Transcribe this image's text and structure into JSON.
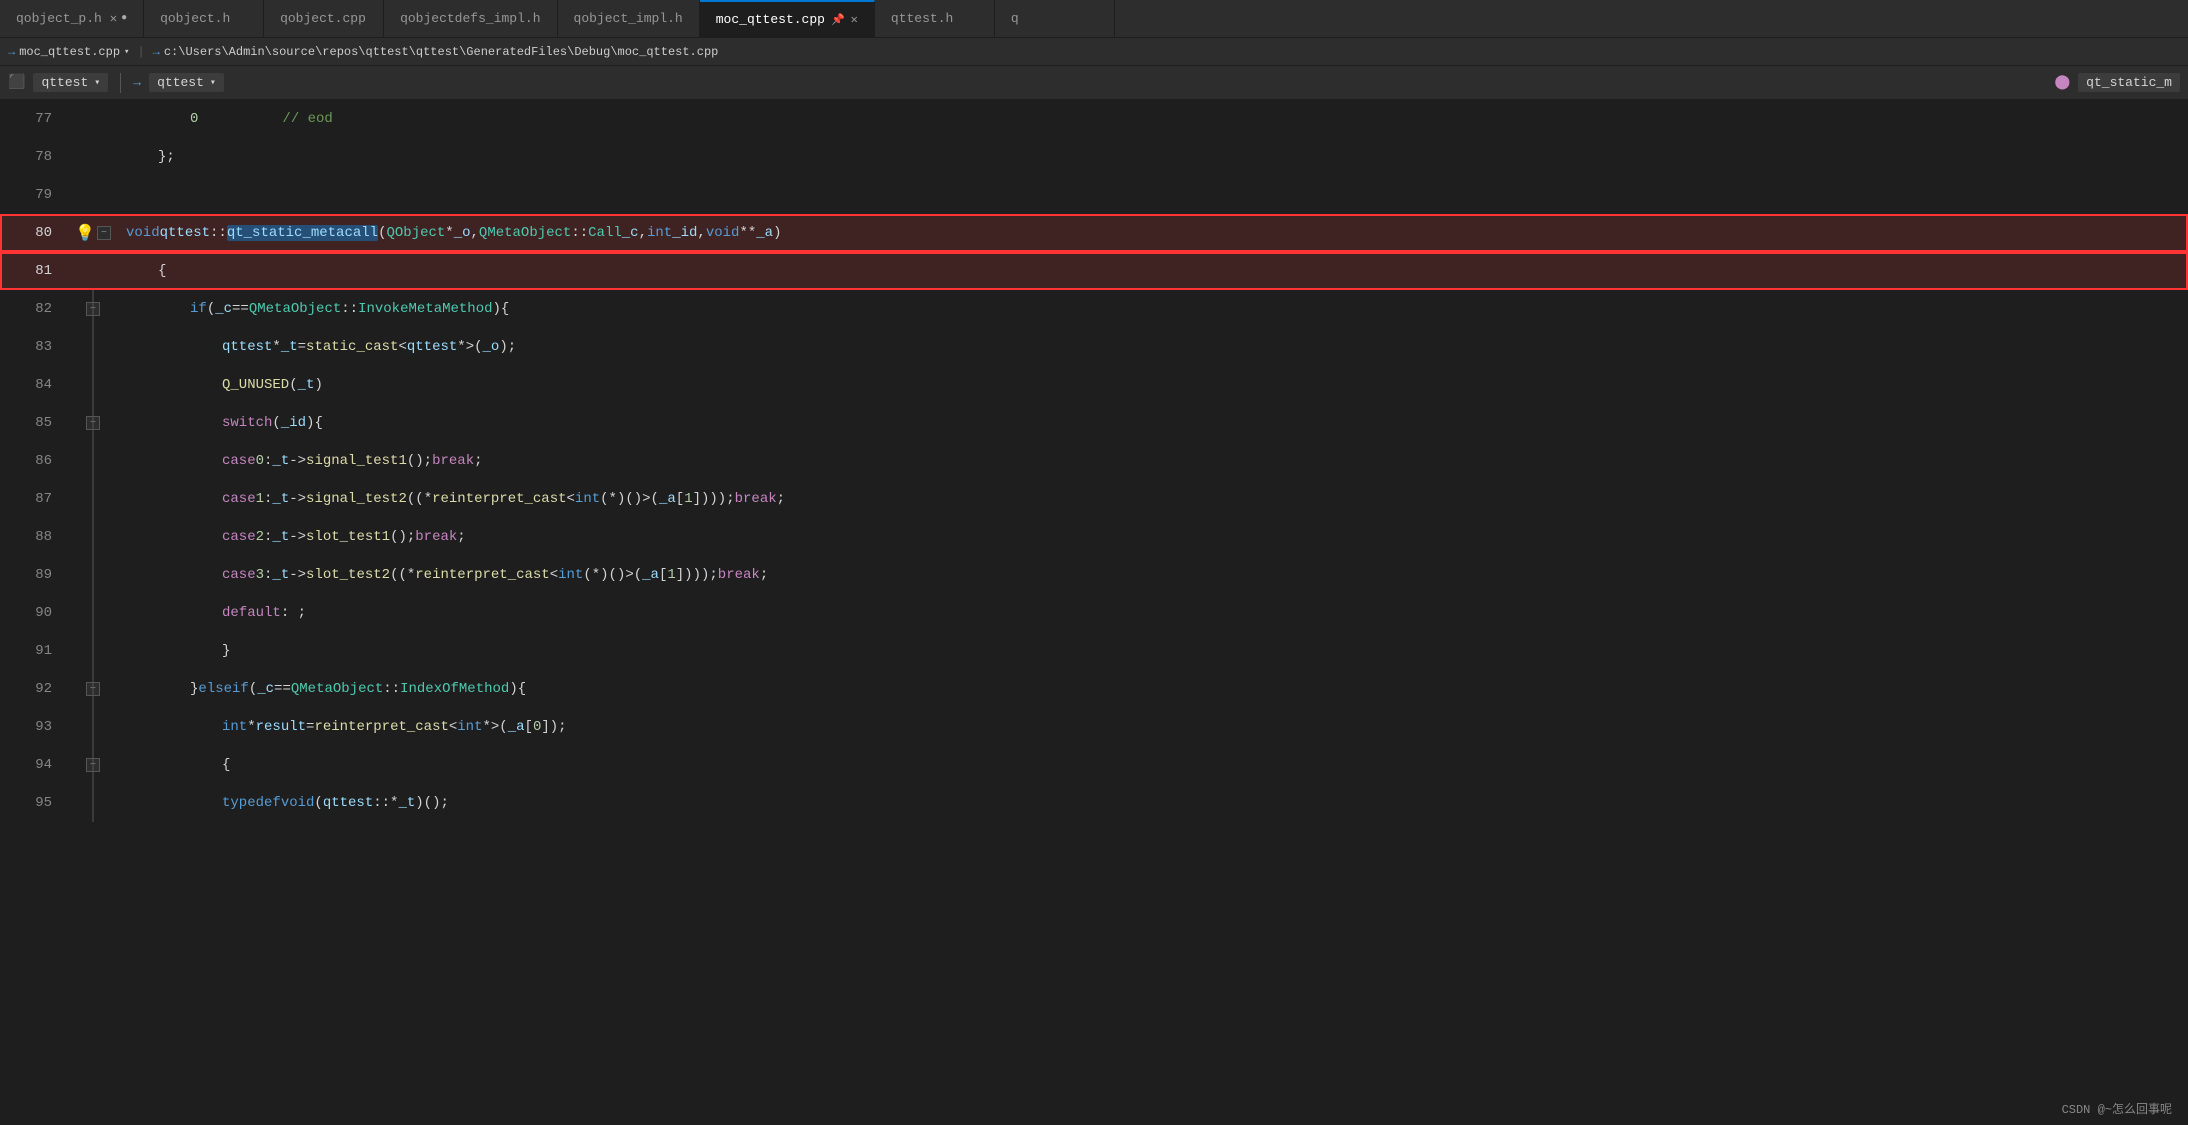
{
  "tabs": [
    {
      "label": "qobject_p.h",
      "modified": true,
      "active": false,
      "id": "tab-qobject-p-h"
    },
    {
      "label": "qobject.h",
      "modified": false,
      "active": false,
      "id": "tab-qobject-h"
    },
    {
      "label": "qobject.cpp",
      "modified": false,
      "active": false,
      "id": "tab-qobject-cpp"
    },
    {
      "label": "qobjectdefs_impl.h",
      "modified": false,
      "active": false,
      "id": "tab-qobjectdefs-impl-h"
    },
    {
      "label": "qobject_impl.h",
      "modified": false,
      "active": false,
      "id": "tab-qobject-impl-h"
    },
    {
      "label": "moc_qttest.cpp",
      "modified": false,
      "active": true,
      "pinned": true,
      "id": "tab-moc-qttest-cpp"
    },
    {
      "label": "qttest.h",
      "modified": false,
      "active": false,
      "id": "tab-qttest-h"
    },
    {
      "label": "q...",
      "modified": false,
      "active": false,
      "id": "tab-q-etc"
    }
  ],
  "breadcrumb": {
    "arrow1": "→",
    "file": "moc_qttest.cpp",
    "arrow2": "→",
    "path": "c:\\Users\\Admin\\source\\repos\\qttest\\qttest\\GeneratedFiles\\Debug\\moc_qttest.cpp"
  },
  "dropdowns": {
    "left_icon": "⬜",
    "left_label": "qttest",
    "arrow": "→",
    "right_label": "qttest",
    "far_right": "qt_static_m"
  },
  "lines": [
    {
      "num": 77,
      "indent": 0,
      "tokens": [
        {
          "t": "0",
          "c": "num"
        },
        {
          "t": "          // eod",
          "c": "cmt"
        }
      ],
      "fold": false,
      "gutter": "spacer"
    },
    {
      "num": 78,
      "indent": 0,
      "tokens": [
        {
          "t": "};",
          "c": "op"
        }
      ],
      "fold": false,
      "gutter": "spacer",
      "pre_indent": "    "
    },
    {
      "num": 79,
      "indent": 0,
      "tokens": [],
      "fold": false,
      "gutter": "none"
    },
    {
      "num": 80,
      "indent": 0,
      "tokens": [],
      "fold": "minus",
      "gutter": "bulb",
      "highlighted": true,
      "raw": "void qttest::<sel>qt_static_metacall</sel>(QObject *_o, QMetaObject::Call _c, int _id, void **_a)"
    },
    {
      "num": 81,
      "indent": 0,
      "tokens": [
        {
          "t": "    {",
          "c": "op"
        }
      ],
      "fold": false,
      "gutter": "spacer",
      "highlighted": true
    },
    {
      "num": 82,
      "indent": 1,
      "tokens": [],
      "fold": "minus",
      "gutter": "line",
      "raw": "        if (_c == QMetaObject::InvokeMetaMethod) {"
    },
    {
      "num": 83,
      "indent": 1,
      "tokens": [],
      "fold": false,
      "gutter": "line",
      "raw": "            qttest *_t = static_cast<qttest *>(_o);"
    },
    {
      "num": 84,
      "indent": 1,
      "tokens": [],
      "fold": false,
      "gutter": "line",
      "raw": "            Q_UNUSED(_t)"
    },
    {
      "num": 85,
      "indent": 1,
      "tokens": [],
      "fold": "minus",
      "gutter": "line",
      "raw": "            switch (_id) {"
    },
    {
      "num": 86,
      "indent": 2,
      "tokens": [],
      "fold": false,
      "gutter": "line",
      "raw": "            case 0: _t->signal_test1(); break;"
    },
    {
      "num": 87,
      "indent": 2,
      "tokens": [],
      "fold": false,
      "gutter": "line",
      "raw": "            case 1: _t->signal_test2((*reinterpret_cast< int(*)>(_a[1]))); break;"
    },
    {
      "num": 88,
      "indent": 2,
      "tokens": [],
      "fold": false,
      "gutter": "line",
      "raw": "            case 2: _t->slot_test1(); break;"
    },
    {
      "num": 89,
      "indent": 2,
      "tokens": [],
      "fold": false,
      "gutter": "line",
      "raw": "            case 3: _t->slot_test2((*reinterpret_cast< int(*)>(_a[1]))); break;"
    },
    {
      "num": 90,
      "indent": 2,
      "tokens": [],
      "fold": false,
      "gutter": "line",
      "raw": "            default: ;"
    },
    {
      "num": 91,
      "indent": 1,
      "tokens": [],
      "fold": false,
      "gutter": "line",
      "raw": "            }"
    },
    {
      "num": 92,
      "indent": 0,
      "tokens": [],
      "fold": "minus",
      "gutter": "line",
      "raw": "        } else if (_c == QMetaObject::IndexOfMethod) {"
    },
    {
      "num": 93,
      "indent": 1,
      "tokens": [],
      "fold": false,
      "gutter": "line",
      "raw": "            int *result = reinterpret_cast<int *>(_a[0]);"
    },
    {
      "num": 94,
      "indent": 0,
      "tokens": [],
      "fold": "minus",
      "gutter": "line",
      "raw": "            {"
    },
    {
      "num": 95,
      "indent": 1,
      "tokens": [],
      "fold": false,
      "gutter": "line",
      "raw": "            typedef void (qttest::* _t)();"
    }
  ],
  "watermark": "CSDN @~怎么回事呢"
}
